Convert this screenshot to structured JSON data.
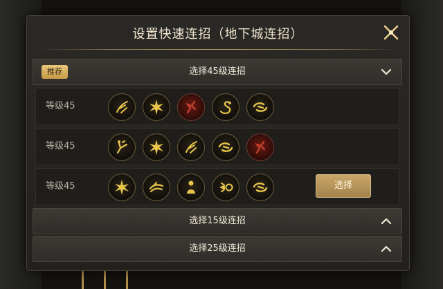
{
  "dialog": {
    "title": "设置快速连招（地下城连招）"
  },
  "sections": [
    {
      "badge": "推荐",
      "label": "选择45级连招",
      "expanded": true
    },
    {
      "label": "选择15级连招",
      "expanded": false
    },
    {
      "label": "选择25级连招",
      "expanded": false
    }
  ],
  "combos": [
    {
      "level": "等级45",
      "skills": [
        "slash-skill-icon",
        "burst-skill-icon",
        "red-strike-skill-icon",
        "serpent-skill-icon",
        "swirl-skill-icon"
      ]
    },
    {
      "level": "等级45",
      "skills": [
        "kick-skill-icon",
        "burst-skill-icon",
        "slash-skill-icon",
        "swirl-skill-icon",
        "red-strike-skill-icon"
      ]
    },
    {
      "level": "等级45",
      "skills": [
        "burst-skill-icon",
        "wave-skill-icon",
        "figure-skill-icon",
        "blast-skill-icon",
        "swirl-skill-icon"
      ],
      "button": "选择"
    }
  ],
  "colors": {
    "accent_gold": "#c9a76a",
    "skill_gold": "#e8c54a",
    "skill_red": "#6a1b12"
  }
}
